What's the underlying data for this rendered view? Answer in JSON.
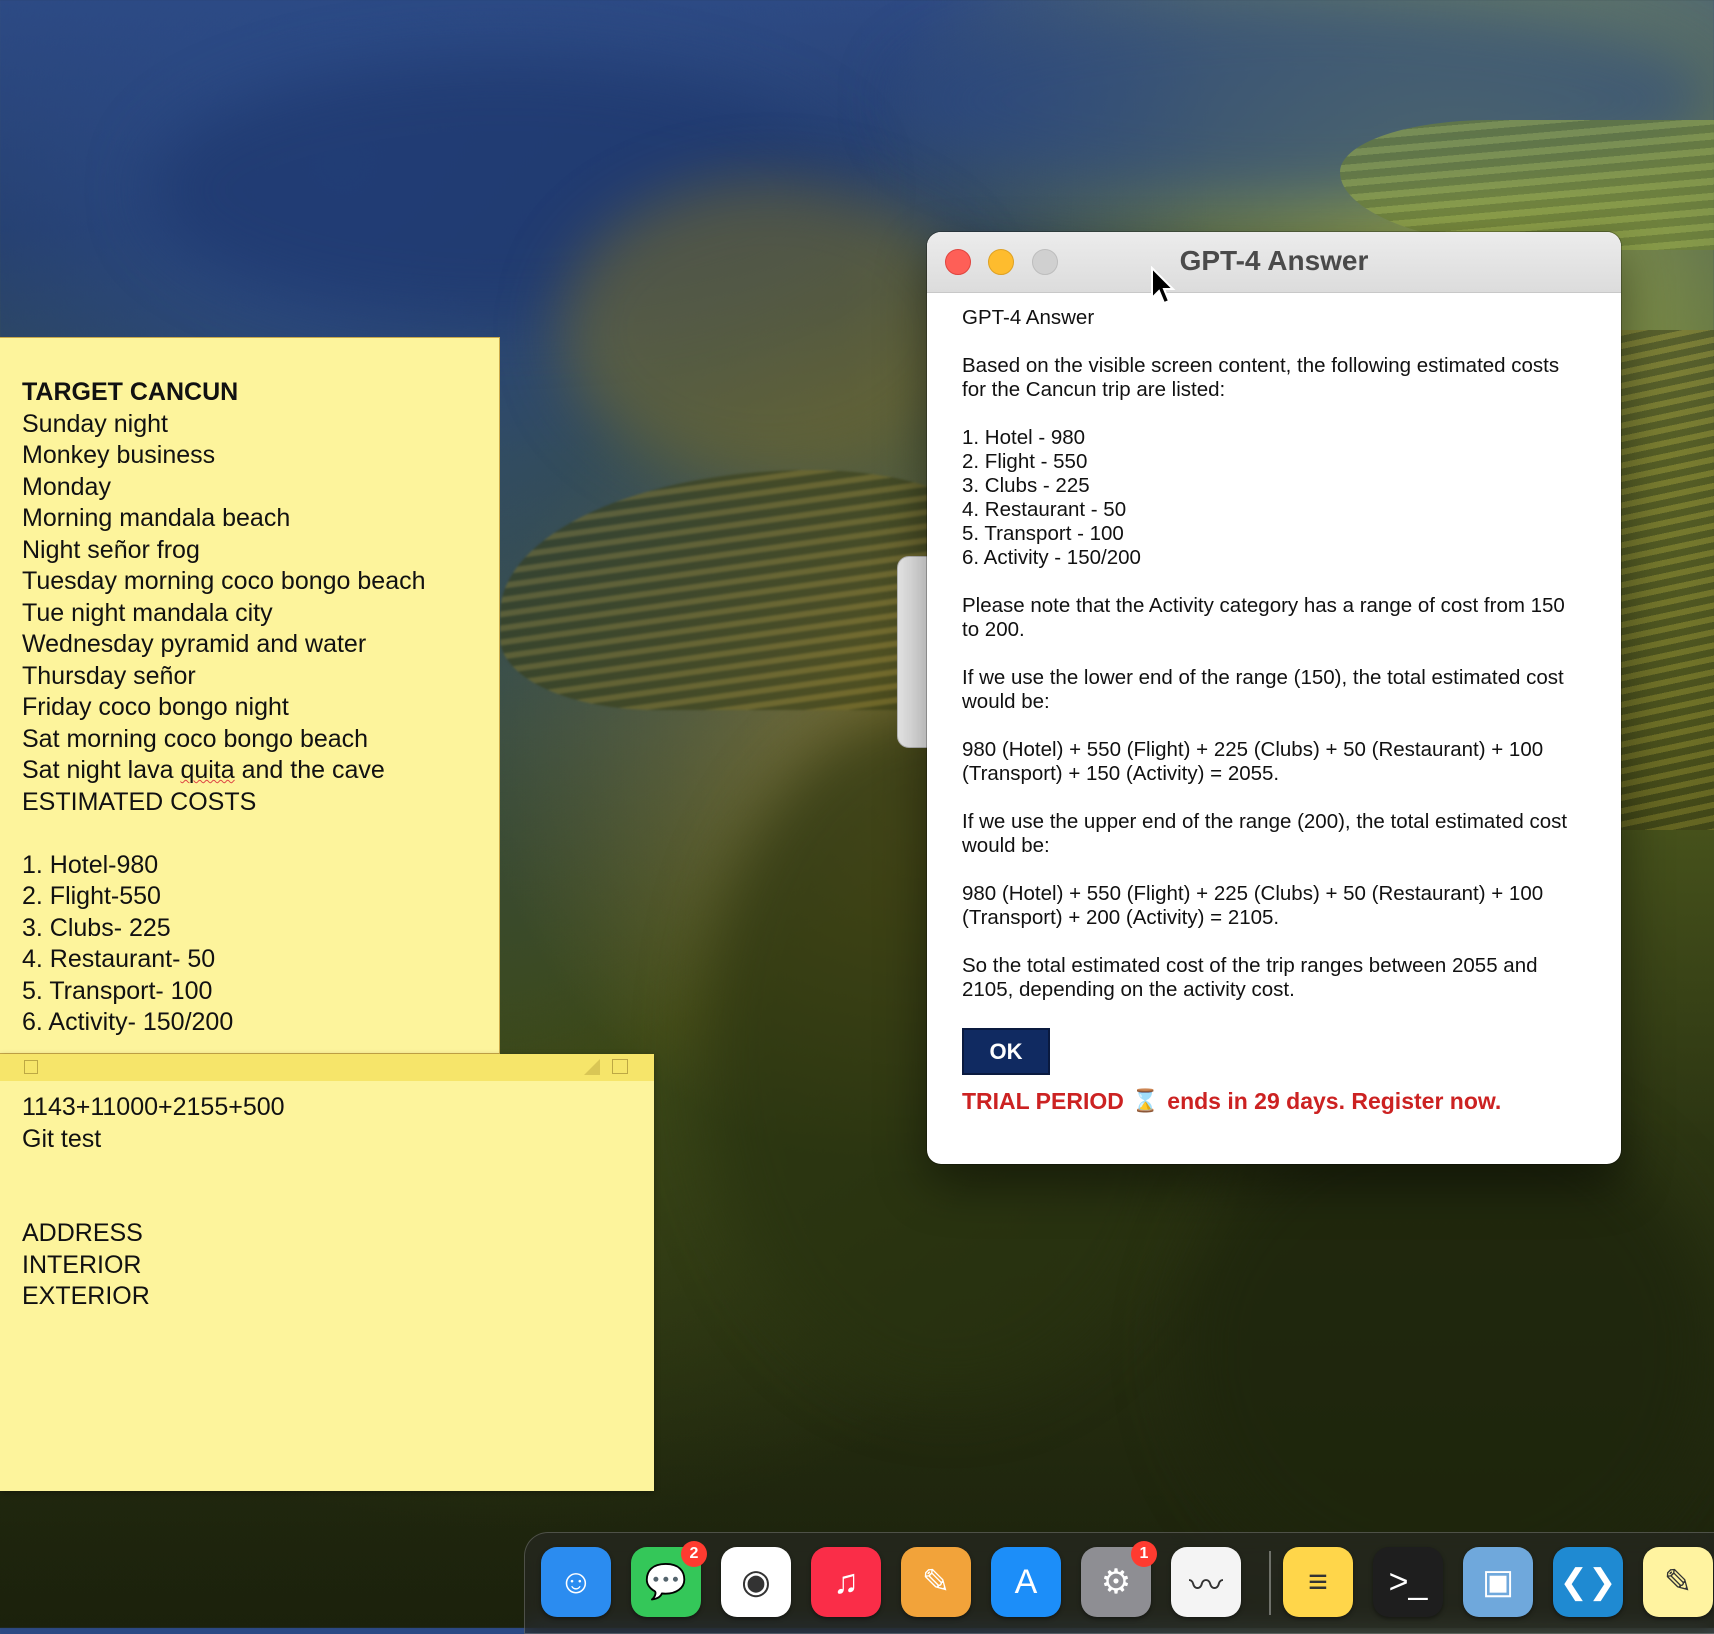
{
  "note1": {
    "lines": [
      "TARGET CANCUN",
      "Sunday night",
      "Monkey business",
      "Monday",
      "Morning mandala beach",
      "Night señor frog",
      "Tuesday morning coco bongo beach",
      "Tue night mandala city",
      "Wednesday pyramid and water",
      "Thursday señor",
      "Friday coco bongo night",
      "Sat morning coco bongo beach",
      "Sat night lava ",
      "ESTIMATED COSTS",
      "",
      "1. Hotel-980",
      "2. Flight-550",
      "3. Clubs- 225",
      "4. Restaurant- 50",
      "5. Transport- 100",
      "6. Activity- 150/200"
    ],
    "sat_night_word": "quita",
    "sat_night_rest": " and the cave"
  },
  "note2": {
    "lines": [
      "1143+11000+2155+500",
      "Git test",
      "",
      "",
      "ADDRESS",
      "INTERIOR",
      "EXTERIOR"
    ]
  },
  "dialog": {
    "title": "GPT-4 Answer",
    "body": {
      "heading": "GPT-4 Answer",
      "intro": "Based on the visible screen content, the following estimated costs for the Cancun trip are listed:",
      "items": [
        "1. Hotel - 980",
        "2. Flight - 550",
        "3. Clubs - 225",
        "4. Restaurant - 50",
        "5. Transport - 100",
        "6. Activity - 150/200"
      ],
      "note": "Please note that the Activity category has a range of cost from 150 to 200.",
      "lower_intro": "If we use the lower end of the range (150), the total estimated cost would be:",
      "lower_calc": "980 (Hotel) + 550 (Flight) + 225 (Clubs) + 50 (Restaurant) + 100 (Transport) + 150 (Activity) = 2055.",
      "upper_intro": "If we use the upper end of the range (200), the total estimated cost would be:",
      "upper_calc": "980 (Hotel) + 550 (Flight) + 225 (Clubs) + 50 (Restaurant) + 100 (Transport) + 200 (Activity) = 2105.",
      "summary": "So the total estimated cost of the trip ranges between 2055 and 2105, depending on the activity cost."
    },
    "ok_label": "OK",
    "trial_prefix": "TRIAL PERIOD",
    "trial_icon": "⌛",
    "trial_suffix": "ends in 29 days. Register now."
  },
  "dock": {
    "apps": [
      {
        "name": "finder-icon",
        "glyph": "☺",
        "color": "#2b8cf0"
      },
      {
        "name": "messages-icon",
        "glyph": "💬",
        "color": "#34c759",
        "badge": "2"
      },
      {
        "name": "chrome-icon",
        "glyph": "◉",
        "color": "#ffffff"
      },
      {
        "name": "music-icon",
        "glyph": "♫",
        "color": "#fa2d48"
      },
      {
        "name": "pages-icon",
        "glyph": "✎",
        "color": "#f2a33a"
      },
      {
        "name": "app-store-icon",
        "glyph": "A",
        "color": "#1c8ef9"
      },
      {
        "name": "system-settings-icon",
        "glyph": "⚙",
        "color": "#8e8e93",
        "badge": "1"
      },
      {
        "name": "freeform-icon",
        "glyph": "〰",
        "color": "#f4f4f4"
      },
      {
        "name": "notes-icon",
        "glyph": "≡",
        "color": "#ffd64a"
      },
      {
        "name": "terminal-icon",
        "glyph": ">_",
        "color": "#1e1e1e"
      },
      {
        "name": "preview-icon",
        "glyph": "▣",
        "color": "#6fa8dc"
      },
      {
        "name": "vscode-icon",
        "glyph": "❮❯",
        "color": "#1f8ad2"
      },
      {
        "name": "stickies-icon",
        "glyph": "✎",
        "color": "#fff3a0"
      }
    ]
  }
}
